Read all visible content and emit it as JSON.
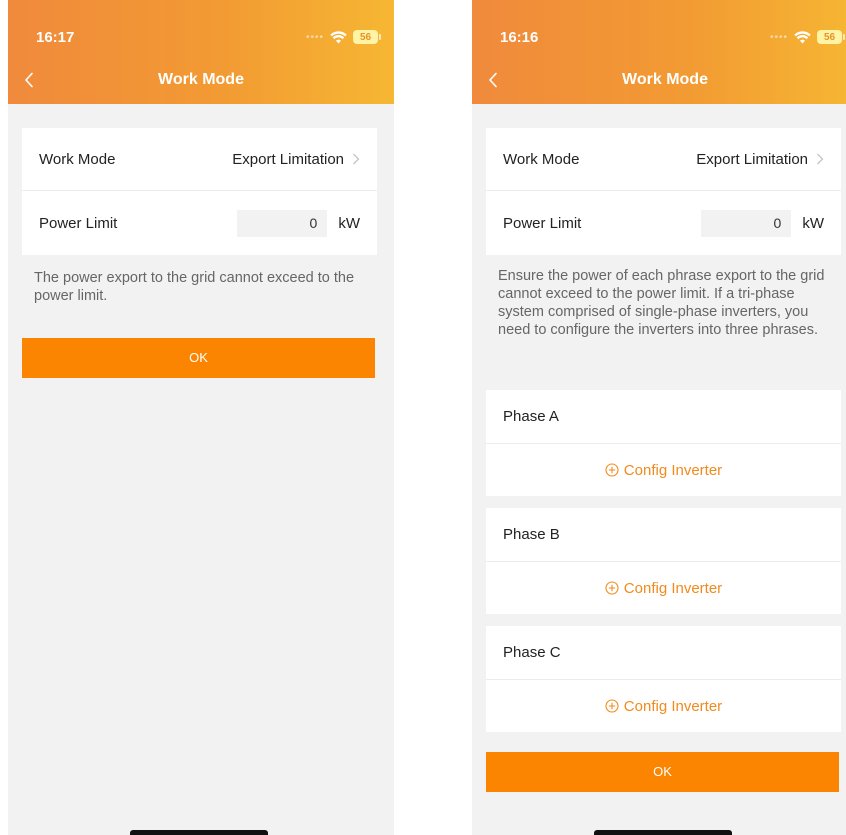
{
  "colors": {
    "header_gradient_start": "#f08a3c",
    "header_gradient_end": "#f6b733",
    "accent": "#fb8400",
    "link": "#f28a1c"
  },
  "left": {
    "status": {
      "time": "16:17",
      "battery": "56"
    },
    "nav": {
      "title": "Work Mode"
    },
    "work_mode": {
      "label": "Work Mode",
      "value": "Export Limitation"
    },
    "power_limit": {
      "label": "Power Limit",
      "value": "0",
      "unit": "kW"
    },
    "description": "The power export to the grid cannot exceed to the power limit.",
    "ok_label": "OK"
  },
  "right": {
    "status": {
      "time": "16:16",
      "battery": "56"
    },
    "nav": {
      "title": "Work Mode"
    },
    "work_mode": {
      "label": "Work Mode",
      "value": "Export Limitation"
    },
    "power_limit": {
      "label": "Power Limit",
      "value": "0",
      "unit": "kW"
    },
    "description": "Ensure the power of each phrase export to the grid cannot exceed to the power limit. If a tri-phase system comprised of single-phase inverters, you need to configure the inverters into three phrases.",
    "phases": [
      {
        "label": "Phase A",
        "action": "Config Inverter"
      },
      {
        "label": "Phase B",
        "action": "Config Inverter"
      },
      {
        "label": "Phase C",
        "action": "Config Inverter"
      }
    ],
    "ok_label": "OK"
  }
}
